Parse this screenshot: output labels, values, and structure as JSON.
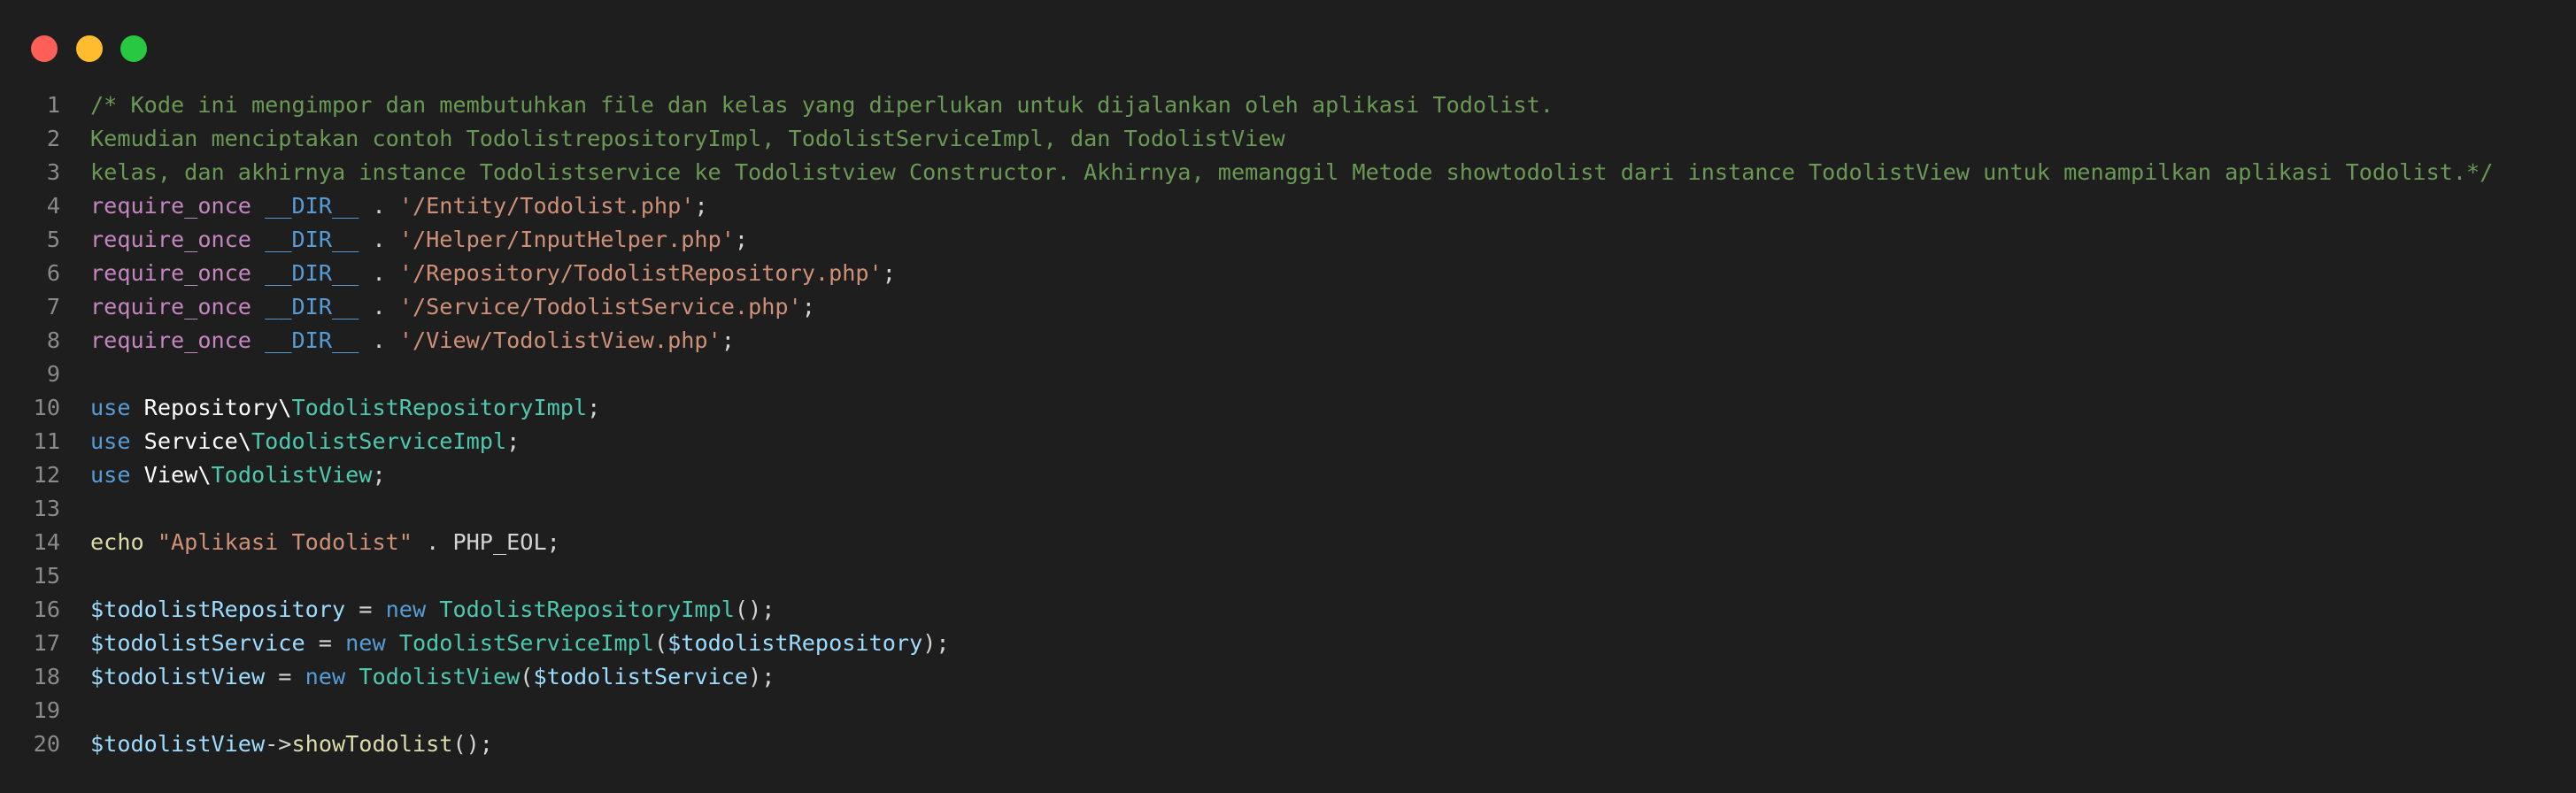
{
  "window": {
    "controls": [
      "close",
      "minimize",
      "maximize"
    ],
    "colors": {
      "close": "#ff5f57",
      "minimize": "#febc2e",
      "maximize": "#28c840",
      "background": "#1e1e1e"
    }
  },
  "code": {
    "language": "php",
    "lines": [
      {
        "n": "1",
        "tokens": [
          {
            "t": "/* Kode ini mengimpor dan membutuhkan file dan kelas yang diperlukan untuk dijalankan oleh aplikasi Todolist.",
            "c": "comment"
          }
        ]
      },
      {
        "n": "2",
        "tokens": [
          {
            "t": "Kemudian menciptakan contoh TodolistrepositoryImpl, TodolistServiceImpl, dan TodolistView",
            "c": "comment"
          }
        ]
      },
      {
        "n": "3",
        "tokens": [
          {
            "t": "kelas, dan akhirnya instance Todolistservice ke Todolistview Constructor. Akhirnya, memanggil Metode showtodolist dari instance TodolistView untuk menampilkan aplikasi Todolist.*/",
            "c": "comment"
          }
        ]
      },
      {
        "n": "4",
        "tokens": [
          {
            "t": "require_once",
            "c": "kw"
          },
          {
            "t": " ",
            "c": "plain"
          },
          {
            "t": "__DIR__",
            "c": "const"
          },
          {
            "t": " . ",
            "c": "plain"
          },
          {
            "t": "'/Entity/Todolist.php'",
            "c": "str"
          },
          {
            "t": ";",
            "c": "plain"
          }
        ]
      },
      {
        "n": "5",
        "tokens": [
          {
            "t": "require_once",
            "c": "kw"
          },
          {
            "t": " ",
            "c": "plain"
          },
          {
            "t": "__DIR__",
            "c": "const"
          },
          {
            "t": " . ",
            "c": "plain"
          },
          {
            "t": "'/Helper/InputHelper.php'",
            "c": "str"
          },
          {
            "t": ";",
            "c": "plain"
          }
        ]
      },
      {
        "n": "6",
        "tokens": [
          {
            "t": "require_once",
            "c": "kw"
          },
          {
            "t": " ",
            "c": "plain"
          },
          {
            "t": "__DIR__",
            "c": "const"
          },
          {
            "t": " . ",
            "c": "plain"
          },
          {
            "t": "'/Repository/TodolistRepository.php'",
            "c": "str"
          },
          {
            "t": ";",
            "c": "plain"
          }
        ]
      },
      {
        "n": "7",
        "tokens": [
          {
            "t": "require_once",
            "c": "kw"
          },
          {
            "t": " ",
            "c": "plain"
          },
          {
            "t": "__DIR__",
            "c": "const"
          },
          {
            "t": " . ",
            "c": "plain"
          },
          {
            "t": "'/Service/TodolistService.php'",
            "c": "str"
          },
          {
            "t": ";",
            "c": "plain"
          }
        ]
      },
      {
        "n": "8",
        "tokens": [
          {
            "t": "require_once",
            "c": "kw"
          },
          {
            "t": " ",
            "c": "plain"
          },
          {
            "t": "__DIR__",
            "c": "const"
          },
          {
            "t": " . ",
            "c": "plain"
          },
          {
            "t": "'/View/TodolistView.php'",
            "c": "str"
          },
          {
            "t": ";",
            "c": "plain"
          }
        ]
      },
      {
        "n": "9",
        "tokens": []
      },
      {
        "n": "10",
        "tokens": [
          {
            "t": "use",
            "c": "const"
          },
          {
            "t": " Repository\\",
            "c": "ns"
          },
          {
            "t": "TodolistRepositoryImpl",
            "c": "type"
          },
          {
            "t": ";",
            "c": "plain"
          }
        ]
      },
      {
        "n": "11",
        "tokens": [
          {
            "t": "use",
            "c": "const"
          },
          {
            "t": " Service\\",
            "c": "ns"
          },
          {
            "t": "TodolistServiceImpl",
            "c": "type"
          },
          {
            "t": ";",
            "c": "plain"
          }
        ]
      },
      {
        "n": "12",
        "tokens": [
          {
            "t": "use",
            "c": "const"
          },
          {
            "t": " View\\",
            "c": "ns"
          },
          {
            "t": "TodolistView",
            "c": "type"
          },
          {
            "t": ";",
            "c": "plain"
          }
        ]
      },
      {
        "n": "13",
        "tokens": []
      },
      {
        "n": "14",
        "tokens": [
          {
            "t": "echo",
            "c": "echo"
          },
          {
            "t": " ",
            "c": "plain"
          },
          {
            "t": "\"Aplikasi Todolist\"",
            "c": "str"
          },
          {
            "t": " . PHP_EOL;",
            "c": "plain"
          }
        ]
      },
      {
        "n": "15",
        "tokens": []
      },
      {
        "n": "16",
        "tokens": [
          {
            "t": "$todolistRepository",
            "c": "var"
          },
          {
            "t": " = ",
            "c": "plain"
          },
          {
            "t": "new",
            "c": "const"
          },
          {
            "t": " ",
            "c": "plain"
          },
          {
            "t": "TodolistRepositoryImpl",
            "c": "type"
          },
          {
            "t": "();",
            "c": "plain"
          }
        ]
      },
      {
        "n": "17",
        "tokens": [
          {
            "t": "$todolistService",
            "c": "var"
          },
          {
            "t": " = ",
            "c": "plain"
          },
          {
            "t": "new",
            "c": "const"
          },
          {
            "t": " ",
            "c": "plain"
          },
          {
            "t": "TodolistServiceImpl",
            "c": "type"
          },
          {
            "t": "(",
            "c": "plain"
          },
          {
            "t": "$todolistRepository",
            "c": "var"
          },
          {
            "t": ");",
            "c": "plain"
          }
        ]
      },
      {
        "n": "18",
        "tokens": [
          {
            "t": "$todolistView",
            "c": "var"
          },
          {
            "t": " = ",
            "c": "plain"
          },
          {
            "t": "new",
            "c": "const"
          },
          {
            "t": " ",
            "c": "plain"
          },
          {
            "t": "TodolistView",
            "c": "type"
          },
          {
            "t": "(",
            "c": "plain"
          },
          {
            "t": "$todolistService",
            "c": "var"
          },
          {
            "t": ");",
            "c": "plain"
          }
        ]
      },
      {
        "n": "19",
        "tokens": []
      },
      {
        "n": "20",
        "tokens": [
          {
            "t": "$todolistView",
            "c": "var"
          },
          {
            "t": "->",
            "c": "plain"
          },
          {
            "t": "showTodolist",
            "c": "fn"
          },
          {
            "t": "();",
            "c": "plain"
          }
        ]
      }
    ]
  }
}
